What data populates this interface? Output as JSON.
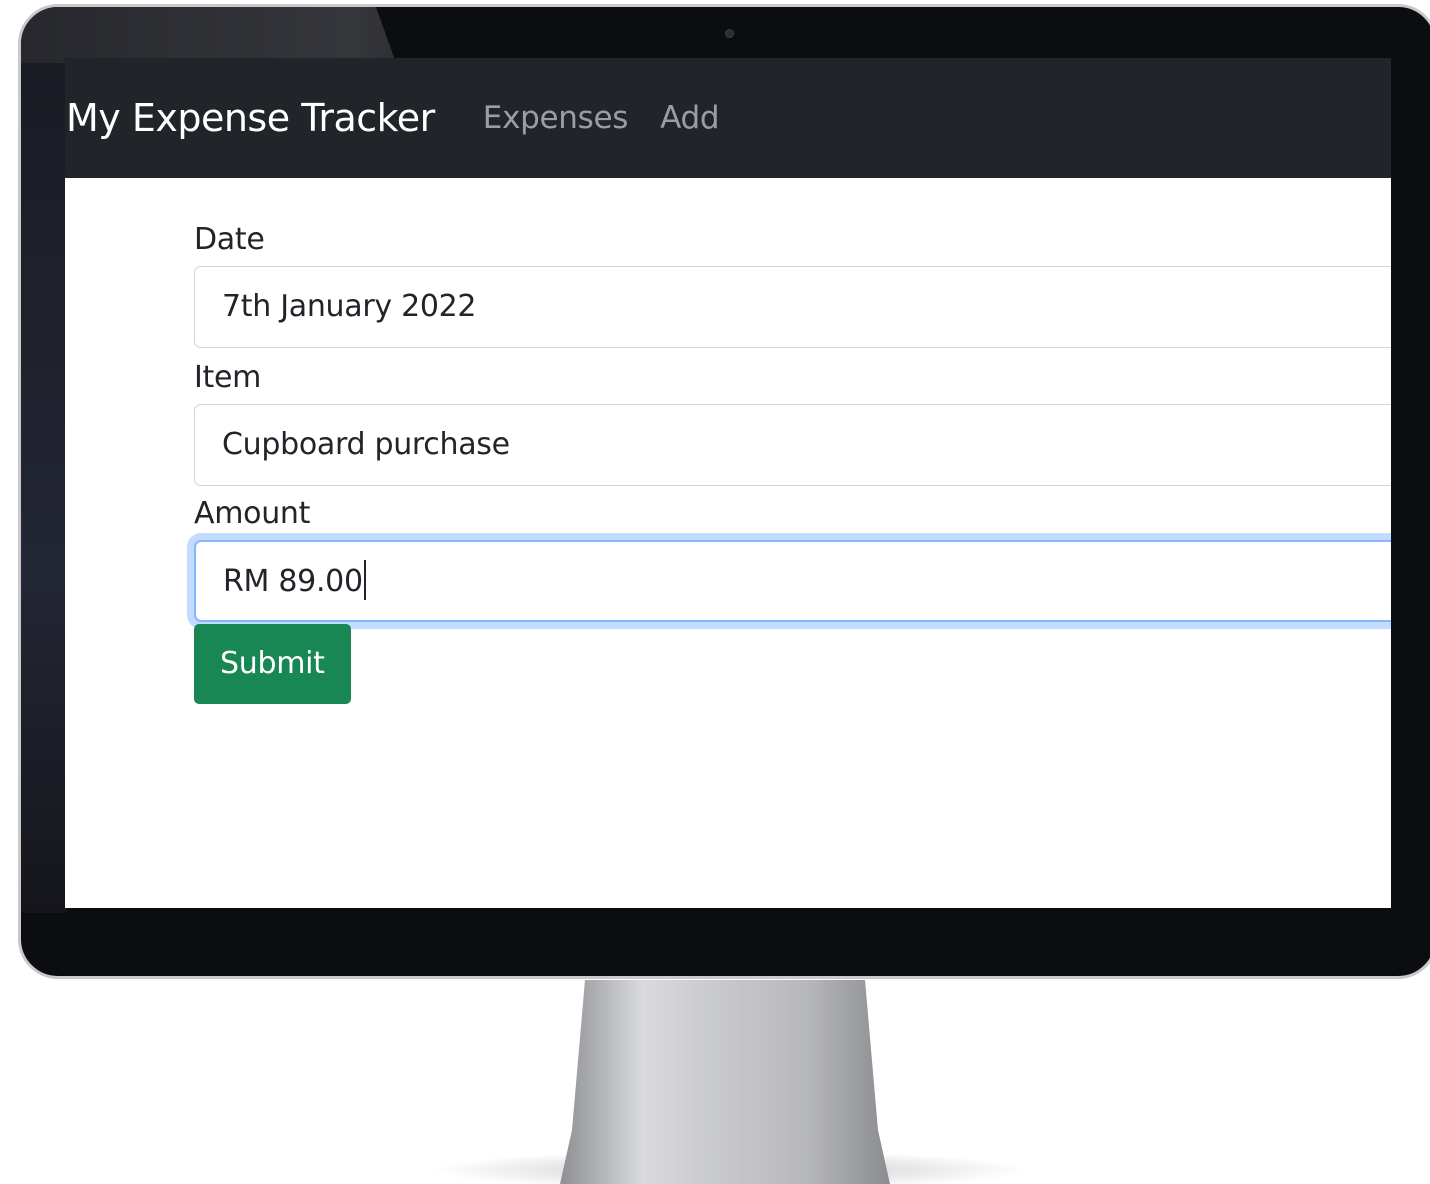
{
  "navbar": {
    "brand": "My Expense Tracker",
    "links": [
      {
        "label": "Expenses"
      },
      {
        "label": "Add"
      }
    ]
  },
  "form": {
    "date": {
      "label": "Date",
      "value": "7th January 2022"
    },
    "item": {
      "label": "Item",
      "value": "Cupboard purchase"
    },
    "amount": {
      "label": "Amount",
      "value": "RM 89.00"
    },
    "submit_label": "Submit"
  },
  "colors": {
    "navbar_bg": "#212529",
    "submit_bg": "#198754",
    "focus_ring": "#86b7fe"
  }
}
